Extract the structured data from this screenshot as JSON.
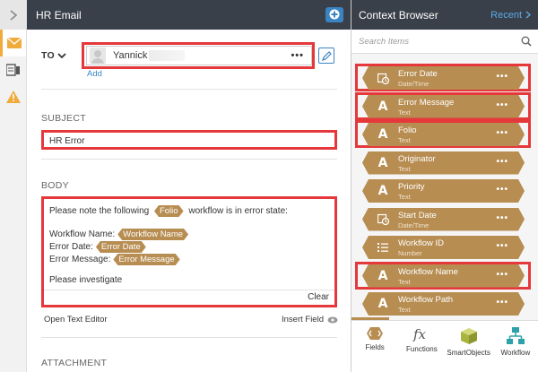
{
  "header": {
    "title": "HR Email",
    "add_icon": "plus-circle-icon"
  },
  "email": {
    "to_label": "TO",
    "recipient": "Yannick",
    "recipient_more": "•••",
    "add_link": "Add",
    "subject_label": "SUBJECT",
    "subject_value": "HR Error",
    "body_label": "BODY",
    "body": {
      "line1_before": "Please note the following",
      "line1_chip": "Folio",
      "line1_after": "workflow is in error state:",
      "line2_label": "Workflow Name:",
      "line2_chip": "Workflow Name",
      "line3_label": "Error Date:",
      "line3_chip": "Error Date",
      "line4_label": "Error Message:",
      "line4_chip": "Error Message",
      "line5": "Please investigate"
    },
    "clear_label": "Clear",
    "open_editor_label": "Open Text Editor",
    "insert_field_label": "Insert Field",
    "attachment_label": "ATTACHMENT"
  },
  "context_browser": {
    "title": "Context Browser",
    "recent_label": "Recent",
    "search_placeholder": "Search Items",
    "items": [
      {
        "name": "Error Date",
        "type": "Date/Time",
        "icon": "calendar-clock-icon",
        "highlighted": true
      },
      {
        "name": "Error Message",
        "type": "Text",
        "icon": "text-icon",
        "highlighted": true
      },
      {
        "name": "Folio",
        "type": "Text",
        "icon": "text-icon",
        "highlighted": true
      },
      {
        "name": "Originator",
        "type": "Text",
        "icon": "text-icon",
        "highlighted": false
      },
      {
        "name": "Priority",
        "type": "Text",
        "icon": "text-icon",
        "highlighted": false
      },
      {
        "name": "Start Date",
        "type": "Date/Time",
        "icon": "calendar-clock-icon",
        "highlighted": false
      },
      {
        "name": "Workflow ID",
        "type": "Number",
        "icon": "number-list-icon",
        "highlighted": false
      },
      {
        "name": "Workflow Name",
        "type": "Text",
        "icon": "text-icon",
        "highlighted": true
      },
      {
        "name": "Workflow Path",
        "type": "Text",
        "icon": "text-icon",
        "highlighted": false
      }
    ],
    "item_more": "•••",
    "tabs": [
      {
        "label": "Fields",
        "icon": "fields-icon"
      },
      {
        "label": "Functions",
        "icon": "functions-icon"
      },
      {
        "label": "SmartObjects",
        "icon": "smartobject-cube-icon"
      },
      {
        "label": "Workflow",
        "icon": "workflow-icon"
      }
    ]
  },
  "colors": {
    "header_bg": "#3a4049",
    "chip": "#b78d52",
    "highlight_red": "#e5383b",
    "accent_blue": "#3b84c4",
    "rail_active": "#f0ab3c"
  }
}
